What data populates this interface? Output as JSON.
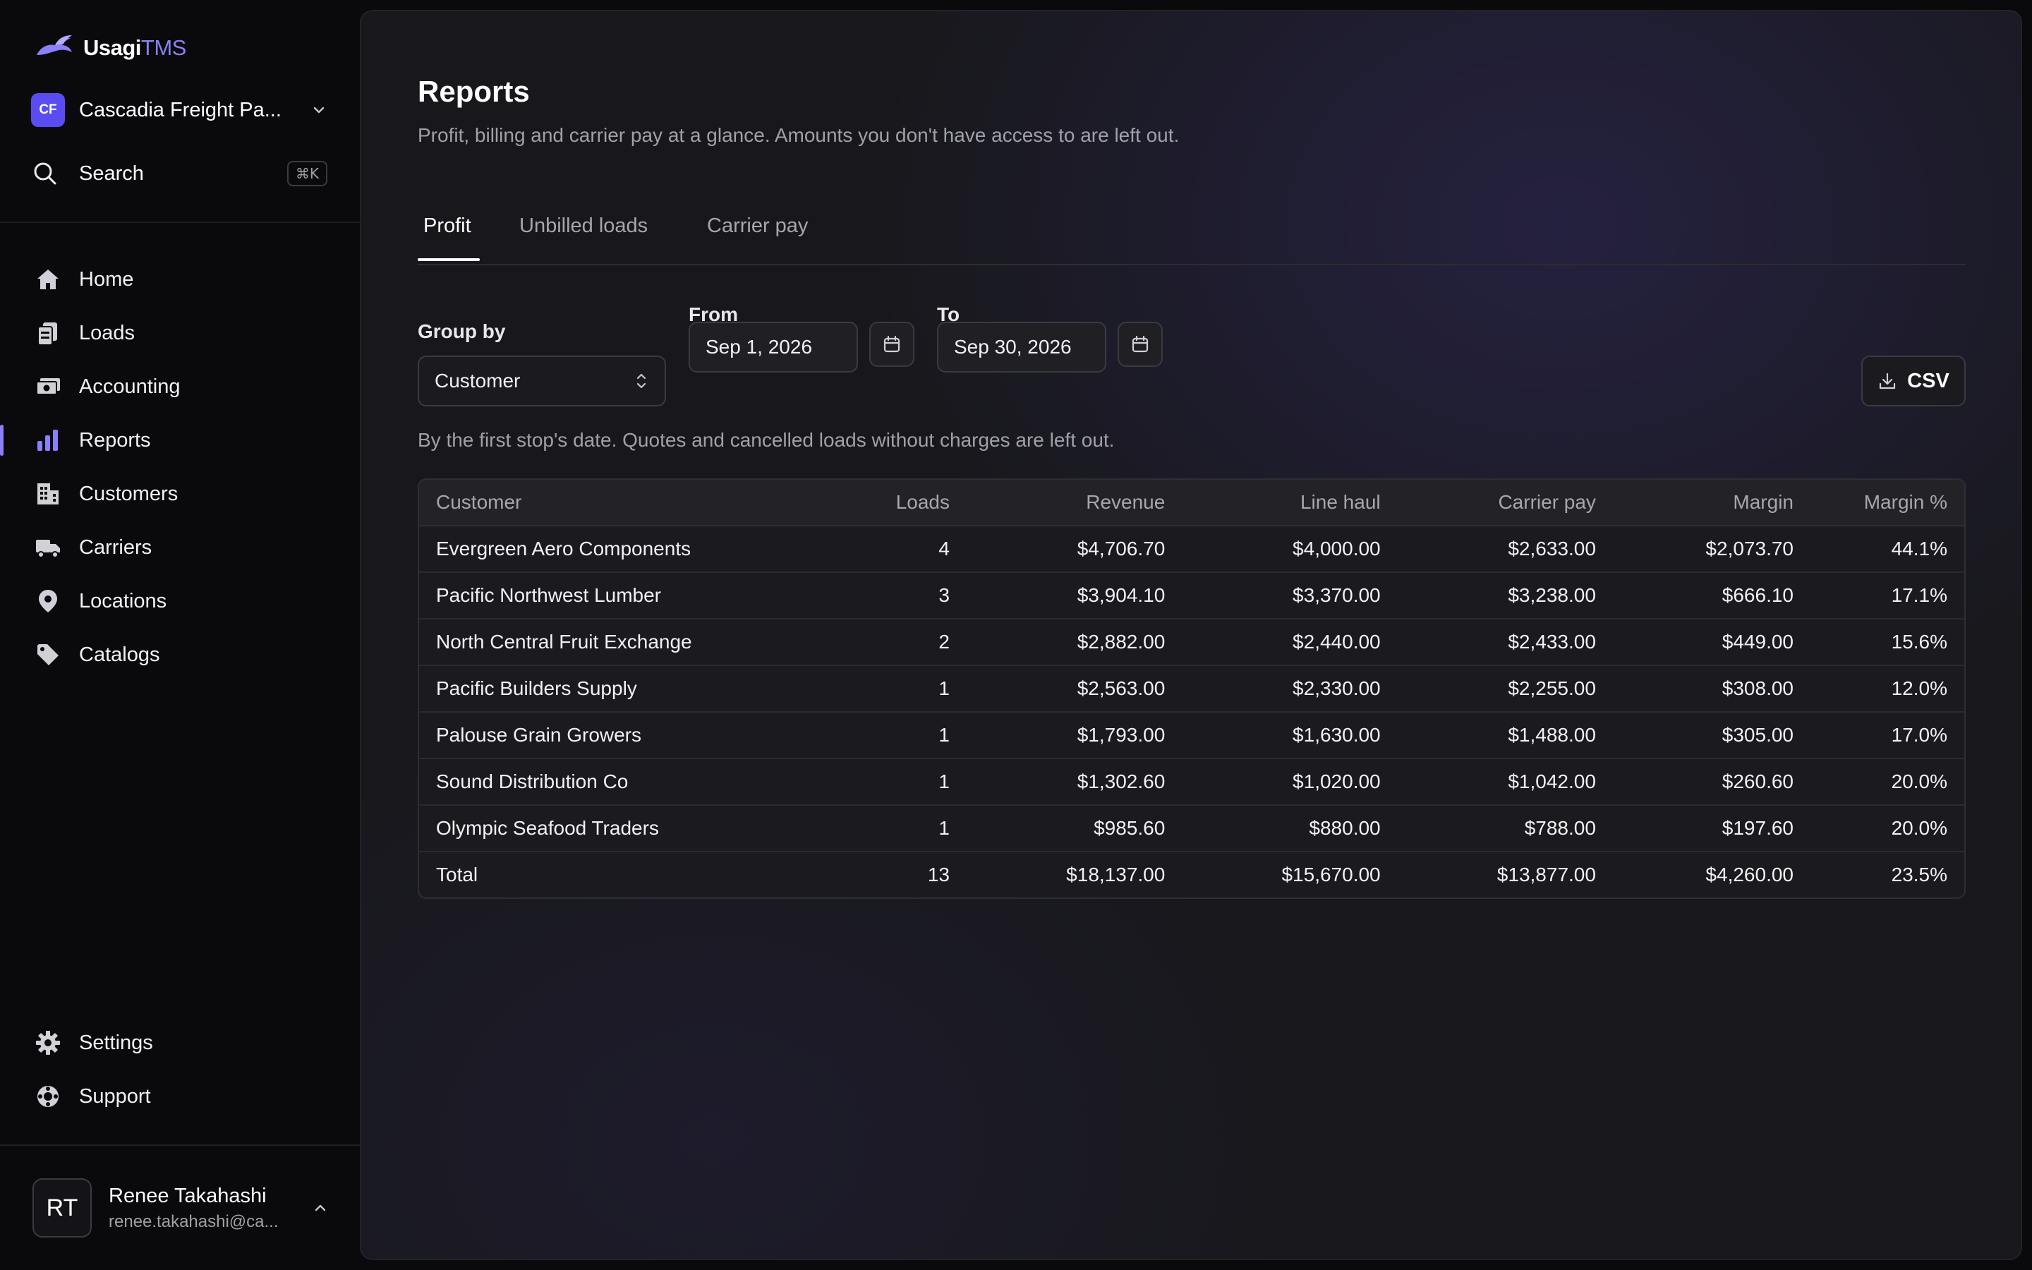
{
  "brand": {
    "name_part1": "Usagi",
    "name_part2": "TMS"
  },
  "org": {
    "initials": "CF",
    "name": "Cascadia Freight Pa..."
  },
  "search": {
    "label": "Search",
    "shortcut": "⌘K"
  },
  "nav": [
    {
      "label": "Home",
      "icon": "home-icon"
    },
    {
      "label": "Loads",
      "icon": "loads-icon"
    },
    {
      "label": "Accounting",
      "icon": "accounting-icon"
    },
    {
      "label": "Reports",
      "icon": "reports-icon",
      "active": true
    },
    {
      "label": "Customers",
      "icon": "customers-icon"
    },
    {
      "label": "Carriers",
      "icon": "carriers-icon"
    },
    {
      "label": "Locations",
      "icon": "location-pin-icon"
    },
    {
      "label": "Catalogs",
      "icon": "tag-icon"
    }
  ],
  "bottom_nav": [
    {
      "label": "Settings",
      "icon": "gear-icon"
    },
    {
      "label": "Support",
      "icon": "lifebuoy-icon"
    }
  ],
  "user": {
    "initials": "RT",
    "name": "Renee Takahashi",
    "email": "renee.takahashi@ca..."
  },
  "page": {
    "title": "Reports",
    "subtitle": "Profit, billing and carrier pay at a glance. Amounts you don't have access to are left out."
  },
  "tabs": [
    {
      "label": "Profit",
      "active": true
    },
    {
      "label": "Unbilled loads"
    },
    {
      "label": "Carrier pay"
    }
  ],
  "filters": {
    "group_by_label": "Group by",
    "group_by_value": "Customer",
    "from_label": "From",
    "from_value": "Sep 1, 2026",
    "to_label": "To",
    "to_value": "Sep 30, 2026",
    "csv_label": "CSV",
    "note": "By the first stop's date. Quotes and cancelled loads without charges are left out."
  },
  "table": {
    "columns": [
      "Customer",
      "Loads",
      "Revenue",
      "Line haul",
      "Carrier pay",
      "Margin",
      "Margin %"
    ],
    "rows": [
      [
        "Evergreen Aero Components",
        "4",
        "$4,706.70",
        "$4,000.00",
        "$2,633.00",
        "$2,073.70",
        "44.1%"
      ],
      [
        "Pacific Northwest Lumber",
        "3",
        "$3,904.10",
        "$3,370.00",
        "$3,238.00",
        "$666.10",
        "17.1%"
      ],
      [
        "North Central Fruit Exchange",
        "2",
        "$2,882.00",
        "$2,440.00",
        "$2,433.00",
        "$449.00",
        "15.6%"
      ],
      [
        "Pacific Builders Supply",
        "1",
        "$2,563.00",
        "$2,330.00",
        "$2,255.00",
        "$308.00",
        "12.0%"
      ],
      [
        "Palouse Grain Growers",
        "1",
        "$1,793.00",
        "$1,630.00",
        "$1,488.00",
        "$305.00",
        "17.0%"
      ],
      [
        "Sound Distribution Co",
        "1",
        "$1,302.60",
        "$1,020.00",
        "$1,042.00",
        "$260.60",
        "20.0%"
      ],
      [
        "Olympic Seafood Traders",
        "1",
        "$985.60",
        "$880.00",
        "$788.00",
        "$197.60",
        "20.0%"
      ]
    ],
    "total": [
      "Total",
      "13",
      "$18,137.00",
      "$15,670.00",
      "$13,877.00",
      "$4,260.00",
      "23.5%"
    ]
  },
  "colors": {
    "accent": "#8b80f9",
    "org_badge": "#5a4cf0"
  }
}
